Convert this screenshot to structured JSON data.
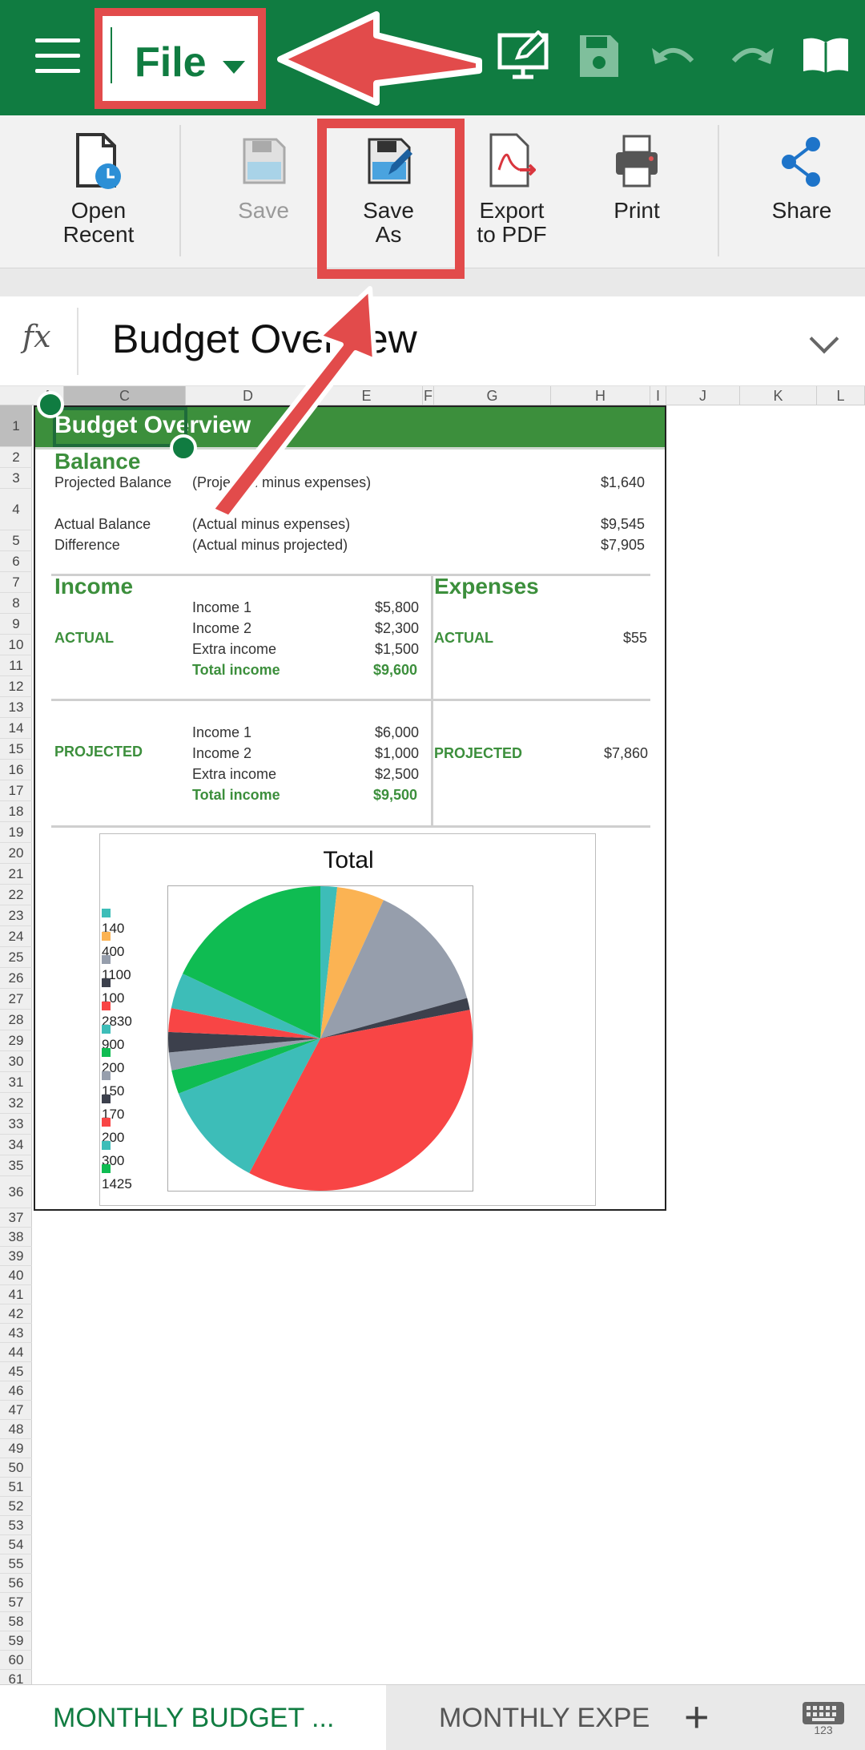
{
  "toolbar": {
    "file_label": "File"
  },
  "ribbon": {
    "items": [
      {
        "label": "Open\nRecent"
      },
      {
        "label": "Save"
      },
      {
        "label": "Save\nAs"
      },
      {
        "label": "Export\nto PDF"
      },
      {
        "label": "Print"
      },
      {
        "label": "Share"
      }
    ]
  },
  "formula_bar": {
    "fx": "fx",
    "value": "Budget Overview"
  },
  "columns": [
    "A",
    "C",
    "D",
    "E",
    "F",
    "G",
    "H",
    "I",
    "J",
    "K",
    "L"
  ],
  "rows": [
    "1",
    "2",
    "3",
    "4",
    "5",
    "6",
    "7",
    "8",
    "9",
    "10",
    "11",
    "12",
    "13",
    "14",
    "15",
    "16",
    "17",
    "18",
    "19",
    "20",
    "21",
    "22",
    "23",
    "24",
    "25",
    "26",
    "27",
    "28",
    "29",
    "30",
    "31",
    "32",
    "33",
    "34",
    "35",
    "36",
    "37",
    "38",
    "39",
    "40",
    "41",
    "42",
    "43",
    "44",
    "45",
    "46",
    "47",
    "48",
    "49",
    "50",
    "51",
    "52",
    "53",
    "54",
    "55",
    "56",
    "57",
    "58",
    "59",
    "60",
    "61"
  ],
  "sheet": {
    "title": "Budget Overview",
    "balance": {
      "heading": "Balance",
      "rows": [
        {
          "label": "Projected Balance",
          "desc": "(Projected  minus expenses)",
          "value": "$1,640"
        },
        {
          "label": "Actual Balance",
          "desc": "(Actual  minus expenses)",
          "value": "$9,545"
        },
        {
          "label": "Difference",
          "desc": "(Actual minus projected)",
          "value": "$7,905"
        }
      ]
    },
    "income": {
      "heading": "Income",
      "actual_label": "ACTUAL",
      "actual": [
        {
          "label": "Income 1",
          "value": "$5,800"
        },
        {
          "label": "Income 2",
          "value": "$2,300"
        },
        {
          "label": "Extra income",
          "value": "$1,500"
        },
        {
          "label": "Total income",
          "value": "$9,600"
        }
      ],
      "projected_label": "PROJECTED",
      "projected": [
        {
          "label": "Income 1",
          "value": "$6,000"
        },
        {
          "label": "Income 2",
          "value": "$1,000"
        },
        {
          "label": "Extra income",
          "value": "$2,500"
        },
        {
          "label": "Total income",
          "value": "$9,500"
        }
      ]
    },
    "expenses": {
      "heading": "Expenses",
      "actual_label": "ACTUAL",
      "actual_value": "$55",
      "projected_label": "PROJECTED",
      "projected_value": "$7,860"
    }
  },
  "chart_data": {
    "type": "pie",
    "title": "Total",
    "legend_position": "right",
    "categories": [
      "140",
      "400",
      "1100",
      "100",
      "2830",
      "900",
      "200",
      "150",
      "170",
      "200",
      "300",
      "1425"
    ],
    "values": [
      140,
      400,
      1100,
      100,
      2830,
      900,
      200,
      150,
      170,
      200,
      300,
      1425
    ],
    "colors": [
      "#3dbdb8",
      "#fbb353",
      "#969eac",
      "#3c404c",
      "#f84545",
      "#3dbdb8",
      "#0fbc52",
      "#969eac",
      "#3c404c",
      "#f84545",
      "#3dbdb8",
      "#0fbc52"
    ]
  },
  "tabs": {
    "active": "MONTHLY BUDGET ...",
    "inactive": "MONTHLY EXPEN",
    "add": "+"
  },
  "icons": {
    "menu": "hamburger-icon",
    "edit": "edit-screen-icon",
    "save": "save-icon",
    "undo": "undo-icon",
    "redo": "redo-icon",
    "read": "book-icon",
    "keyboard": "keyboard-icon"
  },
  "colors": {
    "brand": "#107c41",
    "annotation": "#e24b4b",
    "sheet_green": "#3c8f3c"
  }
}
